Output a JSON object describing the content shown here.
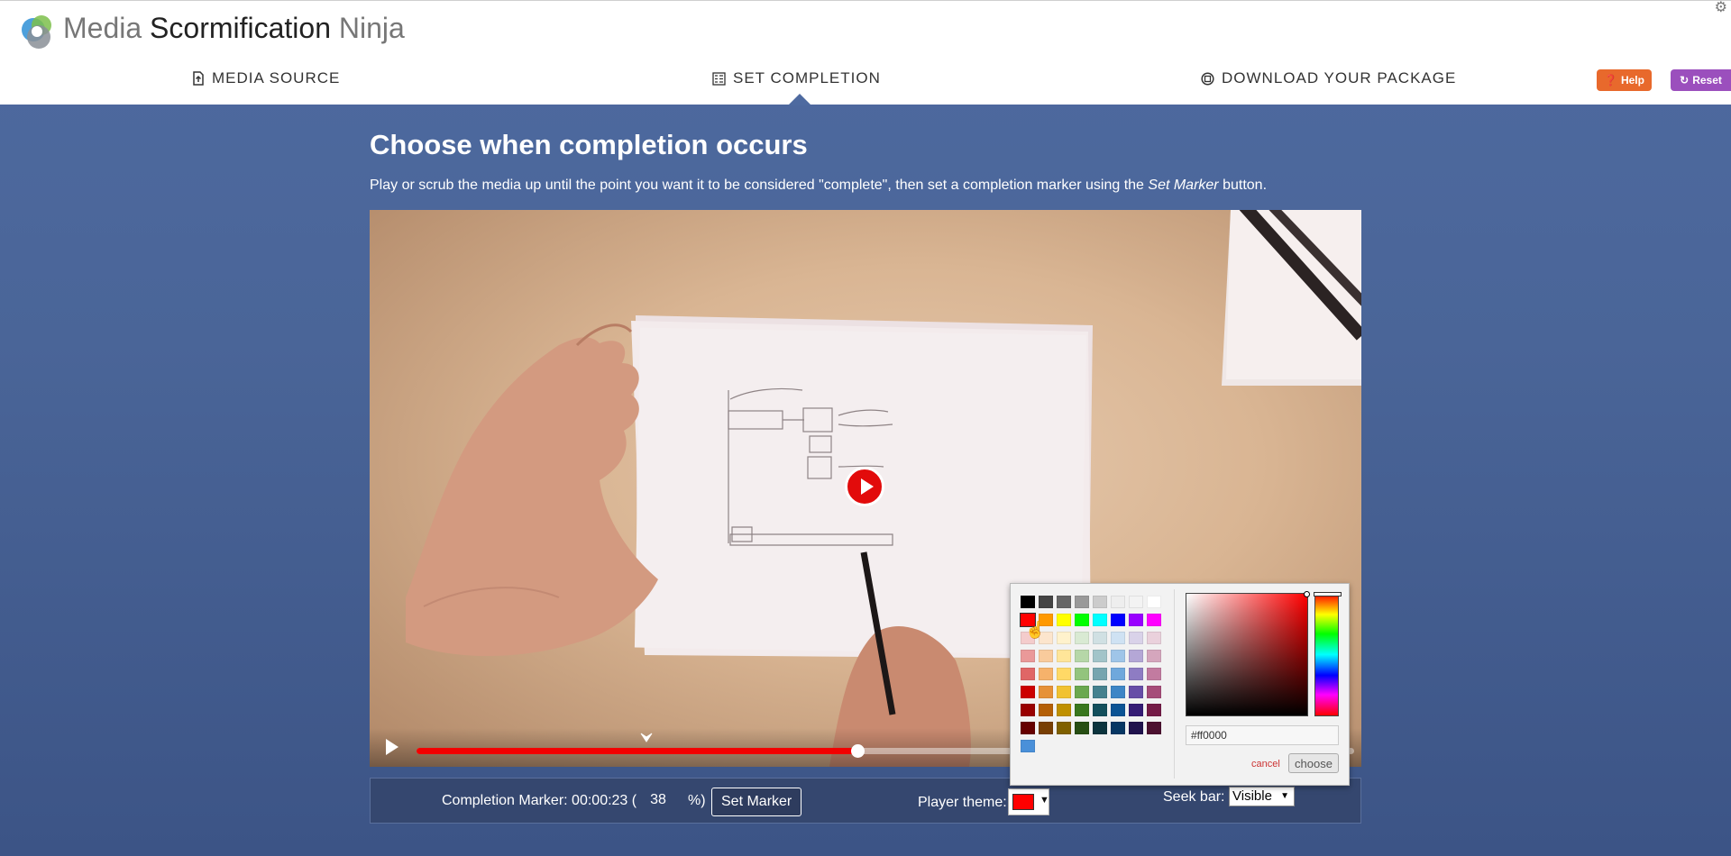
{
  "app": {
    "title_part1": "Media",
    "title_part2": "Scormification",
    "title_part3": "Ninja"
  },
  "nav": [
    {
      "label": "MEDIA SOURCE",
      "icon": "upload-icon"
    },
    {
      "label": "SET COMPLETION",
      "icon": "checklist-icon",
      "active": true
    },
    {
      "label": "DOWNLOAD YOUR PACKAGE",
      "icon": "package-icon"
    }
  ],
  "header_buttons": {
    "help": {
      "label": "Help",
      "icon": "question-circle-icon",
      "color": "#e8692c"
    },
    "reset": {
      "label": "Reset",
      "icon": "refresh-icon",
      "color": "#9b4fbd"
    }
  },
  "main": {
    "heading": "Choose when completion occurs",
    "instructions_before": "Play or scrub the media up until the point you want it to be considered \"complete\", then set a completion marker using the ",
    "instructions_emphasis": "Set Marker",
    "instructions_after": " button."
  },
  "player": {
    "progress_fraction": 0.47,
    "marker_fraction": 0.245,
    "accent_color": "#f20000"
  },
  "completion": {
    "label": "Completion Marker: 00:00:23 (",
    "percent_value": "38",
    "percent_suffix": "%)",
    "set_marker_label": "Set Marker"
  },
  "theme": {
    "label": "Player theme:",
    "selected_color": "#ff0000"
  },
  "seekbar": {
    "label": "Seek bar:",
    "selected": "Visible"
  },
  "color_picker": {
    "hex_value": "#ff0000",
    "cancel_label": "cancel",
    "choose_label": "choose",
    "palette": [
      [
        "#000000",
        "#444444",
        "#666666",
        "#999999",
        "#cccccc",
        "#eeeeee",
        "#f3f3f3",
        "#ffffff"
      ],
      [
        "#ff0000",
        "#ff9900",
        "#ffff00",
        "#00ff00",
        "#00ffff",
        "#0000ff",
        "#9900ff",
        "#ff00ff"
      ],
      [
        "#f4cccc",
        "#fce5cd",
        "#fff2cc",
        "#d9ead3",
        "#d0e0e3",
        "#cfe2f3",
        "#d9d2e9",
        "#ead1dc"
      ],
      [
        "#ea9999",
        "#f9cb9c",
        "#ffe599",
        "#b6d7a8",
        "#a2c4c9",
        "#9fc5e8",
        "#b4a7d6",
        "#d5a6bd"
      ],
      [
        "#e06666",
        "#f6b26b",
        "#ffd966",
        "#93c47d",
        "#76a5af",
        "#6fa8dc",
        "#8e7cc3",
        "#c27ba0"
      ],
      [
        "#cc0000",
        "#e69138",
        "#f1c232",
        "#6aa84f",
        "#45818e",
        "#3d85c6",
        "#674ea7",
        "#a64d79"
      ],
      [
        "#990000",
        "#b45f06",
        "#bf9000",
        "#38761d",
        "#134f5c",
        "#0b5394",
        "#351c75",
        "#741b47"
      ],
      [
        "#660000",
        "#783f04",
        "#7f6000",
        "#274e13",
        "#0c343d",
        "#073763",
        "#20124d",
        "#4c1130"
      ],
      [
        "#4a90d9"
      ]
    ]
  }
}
